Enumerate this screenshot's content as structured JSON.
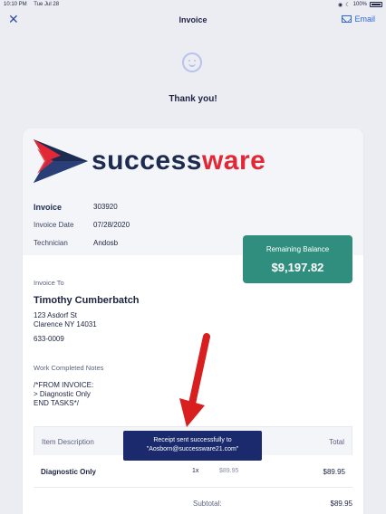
{
  "status_bar": {
    "time": "10:10 PM",
    "date": "Tue Jul 28",
    "battery": "100%"
  },
  "nav": {
    "title": "Invoice",
    "email_label": "Email",
    "close_glyph": "✕"
  },
  "thank_you": "Thank you!",
  "logo": {
    "part1": "success",
    "part2": "ware",
    "colors": {
      "navy": "#1d2b50",
      "red": "#e22836"
    }
  },
  "invoice": {
    "invoice_label": "Invoice",
    "invoice_number": "303920",
    "date_label": "Invoice Date",
    "date_value": "07/28/2020",
    "tech_label": "Technician",
    "tech_value": "Andosb"
  },
  "balance": {
    "label": "Remaining Balance",
    "amount": "$9,197.82",
    "color": "#2f8e7e"
  },
  "invoice_to": {
    "label": "Invoice To",
    "name": "Timothy Cumberbatch",
    "address_line1": "123 Asdorf St",
    "address_line2": "Clarence NY 14031",
    "phone": "633-0009"
  },
  "work_notes": {
    "label": "Work Completed Notes",
    "line1": "/*FROM INVOICE:",
    "line2": "> Diagnostic Only",
    "line3": "END TASKS*/"
  },
  "table": {
    "col_description": "Item Description",
    "col_total": "Total",
    "rows": [
      {
        "description": "Diagnostic Only",
        "qty": "1x",
        "rate": "$89.95",
        "total": "$89.95"
      }
    ],
    "subtotal_label": "Subtotal:",
    "subtotal_value": "$89.95"
  },
  "toast": {
    "line1": "Receipt sent successfully to",
    "line2": "\"Aosborn@successware21.com\""
  },
  "icons": {
    "close": "close-icon",
    "email": "mail-icon",
    "smiley": "smiley-icon",
    "arrow": "red-arrow-annotation"
  }
}
